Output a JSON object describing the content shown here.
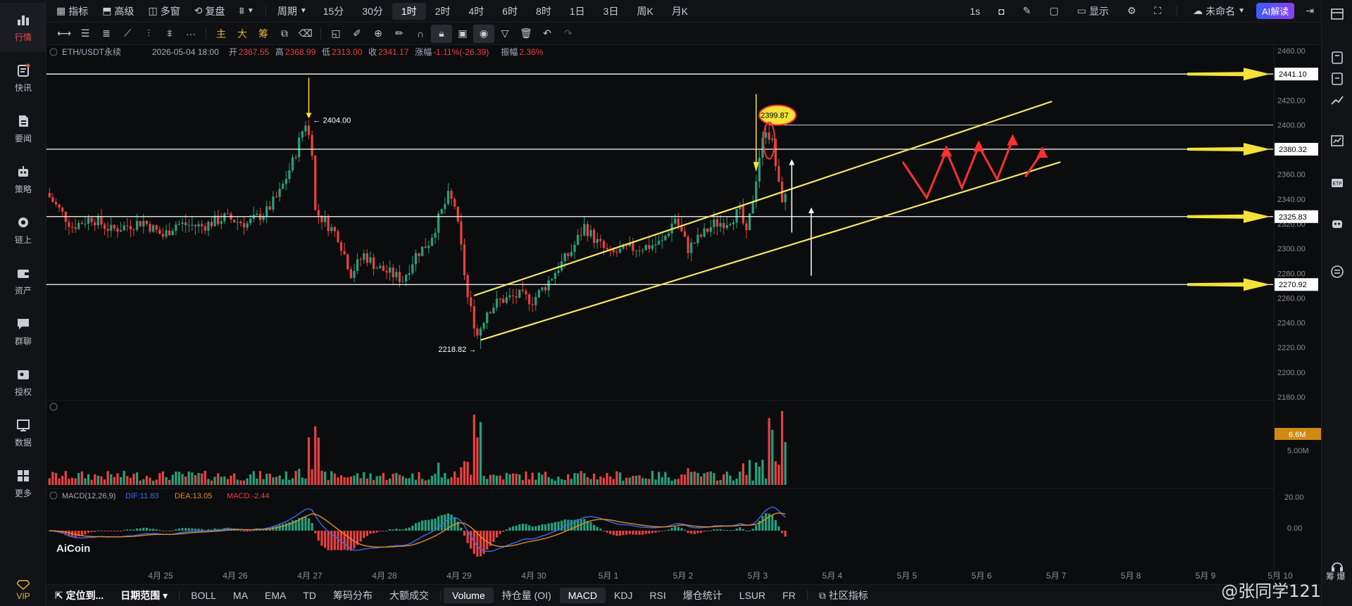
{
  "sidebar": {
    "items": [
      {
        "label": "行情",
        "icon": "chart-bars-icon",
        "active": true
      },
      {
        "label": "快讯",
        "icon": "news-flash-icon"
      },
      {
        "label": "要闻",
        "icon": "document-icon"
      },
      {
        "label": "策略",
        "icon": "robot-icon"
      },
      {
        "label": "链上",
        "icon": "chain-icon"
      },
      {
        "label": "资产",
        "icon": "wallet-icon"
      },
      {
        "label": "群聊",
        "icon": "chat-icon"
      },
      {
        "label": "授权",
        "icon": "key-icon"
      },
      {
        "label": "数据",
        "icon": "data-board-icon"
      },
      {
        "label": "更多",
        "icon": "grid-icon"
      }
    ],
    "vip": "VIP"
  },
  "topbar": {
    "tools": [
      {
        "label": "指标",
        "icon": "indicator-icon"
      },
      {
        "label": "高级",
        "icon": "advanced-icon"
      },
      {
        "label": "多窗",
        "icon": "multi-window-icon"
      },
      {
        "label": "复盘",
        "icon": "replay-icon"
      },
      {
        "label": "",
        "icon": "chart-style-icon"
      }
    ],
    "period_label": "周期",
    "timeframes": [
      "15分",
      "30分",
      "1时",
      "2时",
      "4时",
      "6时",
      "8时",
      "1日",
      "3日",
      "周K",
      "月K"
    ],
    "selected_timeframe": "1时",
    "right": {
      "interval": "1s",
      "display": "显示",
      "layout_name": "未命名",
      "ai_button": "AI解读"
    }
  },
  "legend": {
    "symbol": "ETH/USDT永续",
    "time": "2026-05-04 18:00",
    "open_label": "开",
    "open": "2367.55",
    "high_label": "高",
    "high": "2368.99",
    "low_label": "低",
    "low": "2313.00",
    "close_label": "收",
    "close": "2341.17",
    "change_label": "涨幅",
    "change": "-1.11%(-26.39)",
    "amp_label": "振幅",
    "amp": "2.36%"
  },
  "macd_legend": {
    "name": "MACD(12,26,9)",
    "dif": "DIF:11.83",
    "dea": "DEA:13.05",
    "macd": "MACD:-2.44"
  },
  "chart_data": {
    "type": "candlestick",
    "price_axis": {
      "min": 2180,
      "max": 2460,
      "ticks": [
        2460,
        2440,
        2420,
        2400,
        2380,
        2360,
        2340,
        2320,
        2300,
        2280,
        2260,
        2240,
        2220,
        2200,
        2180
      ]
    },
    "date_labels": [
      "4月 25",
      "4月 26",
      "4月 27",
      "4月 28",
      "4月 29",
      "4月 30",
      "5月 1",
      "5月 2",
      "5月 3",
      "5月 4",
      "5月 5",
      "5月 6",
      "5月 7",
      "5月 8",
      "5月 9",
      "5月 10"
    ],
    "horizontal_levels": [
      2441.1,
      2380.32,
      2325.83,
      2270.92
    ],
    "level_labels": [
      "2441.10",
      "2380.32",
      "2325.83",
      "2270.92"
    ],
    "extra_line": 2399.87,
    "annotations": {
      "high": "2404.00",
      "low": "2218.82",
      "recent_high": "2399.87"
    },
    "anchors": [
      [
        0,
        2345
      ],
      [
        8,
        2318
      ],
      [
        14,
        2325
      ],
      [
        20,
        2315
      ],
      [
        30,
        2322
      ],
      [
        36,
        2310
      ],
      [
        40,
        2320
      ],
      [
        48,
        2318
      ],
      [
        55,
        2325
      ],
      [
        62,
        2320
      ],
      [
        68,
        2330
      ],
      [
        72,
        2345
      ],
      [
        76,
        2370
      ],
      [
        79,
        2395
      ],
      [
        80,
        2402
      ],
      [
        82,
        2380
      ],
      [
        83,
        2330
      ],
      [
        86,
        2322
      ],
      [
        90,
        2310
      ],
      [
        94,
        2280
      ],
      [
        98,
        2295
      ],
      [
        102,
        2285
      ],
      [
        106,
        2280
      ],
      [
        110,
        2275
      ],
      [
        114,
        2295
      ],
      [
        118,
        2305
      ],
      [
        122,
        2330
      ],
      [
        124,
        2342
      ],
      [
        126,
        2335
      ],
      [
        128,
        2300
      ],
      [
        130,
        2260
      ],
      [
        133,
        2230
      ],
      [
        136,
        2250
      ],
      [
        140,
        2258
      ],
      [
        146,
        2262
      ],
      [
        150,
        2258
      ],
      [
        154,
        2270
      ],
      [
        158,
        2285
      ],
      [
        162,
        2298
      ],
      [
        166,
        2318
      ],
      [
        170,
        2305
      ],
      [
        174,
        2295
      ],
      [
        180,
        2300
      ],
      [
        186,
        2302
      ],
      [
        190,
        2305
      ],
      [
        194,
        2325
      ],
      [
        198,
        2300
      ],
      [
        202,
        2310
      ],
      [
        206,
        2320
      ],
      [
        210,
        2322
      ],
      [
        214,
        2330
      ],
      [
        216,
        2310
      ],
      [
        218,
        2340
      ],
      [
        220,
        2375
      ],
      [
        222,
        2398
      ],
      [
        224,
        2385
      ],
      [
        226,
        2350
      ],
      [
        227,
        2341
      ]
    ],
    "volume_axis": {
      "max_label": "6.6M",
      "mid_label": "5.00M"
    },
    "macd_axis": {
      "ticks": [
        "20.00",
        "0.00"
      ]
    }
  },
  "bottombar": {
    "items": [
      "定位到...",
      "日期范围",
      "BOLL",
      "MA",
      "EMA",
      "TD",
      "筹码分布",
      "大额成交",
      "Volume",
      "持仓量 (OI)",
      "MACD",
      "KDJ",
      "RSI",
      "爆仓统计",
      "LSUR",
      "FR",
      "社区指标"
    ],
    "selected": [
      "Volume",
      "MACD"
    ]
  },
  "watermark": "@张同学121",
  "logo": "AiCoin",
  "colors": {
    "up": "#26a17b",
    "down": "#e84142",
    "level": "#ffffff",
    "channel": "#f5e663",
    "arrow_red": "#ff3030",
    "badge_yellow": "#f2e23a",
    "vol_badge": "#d08a14"
  }
}
